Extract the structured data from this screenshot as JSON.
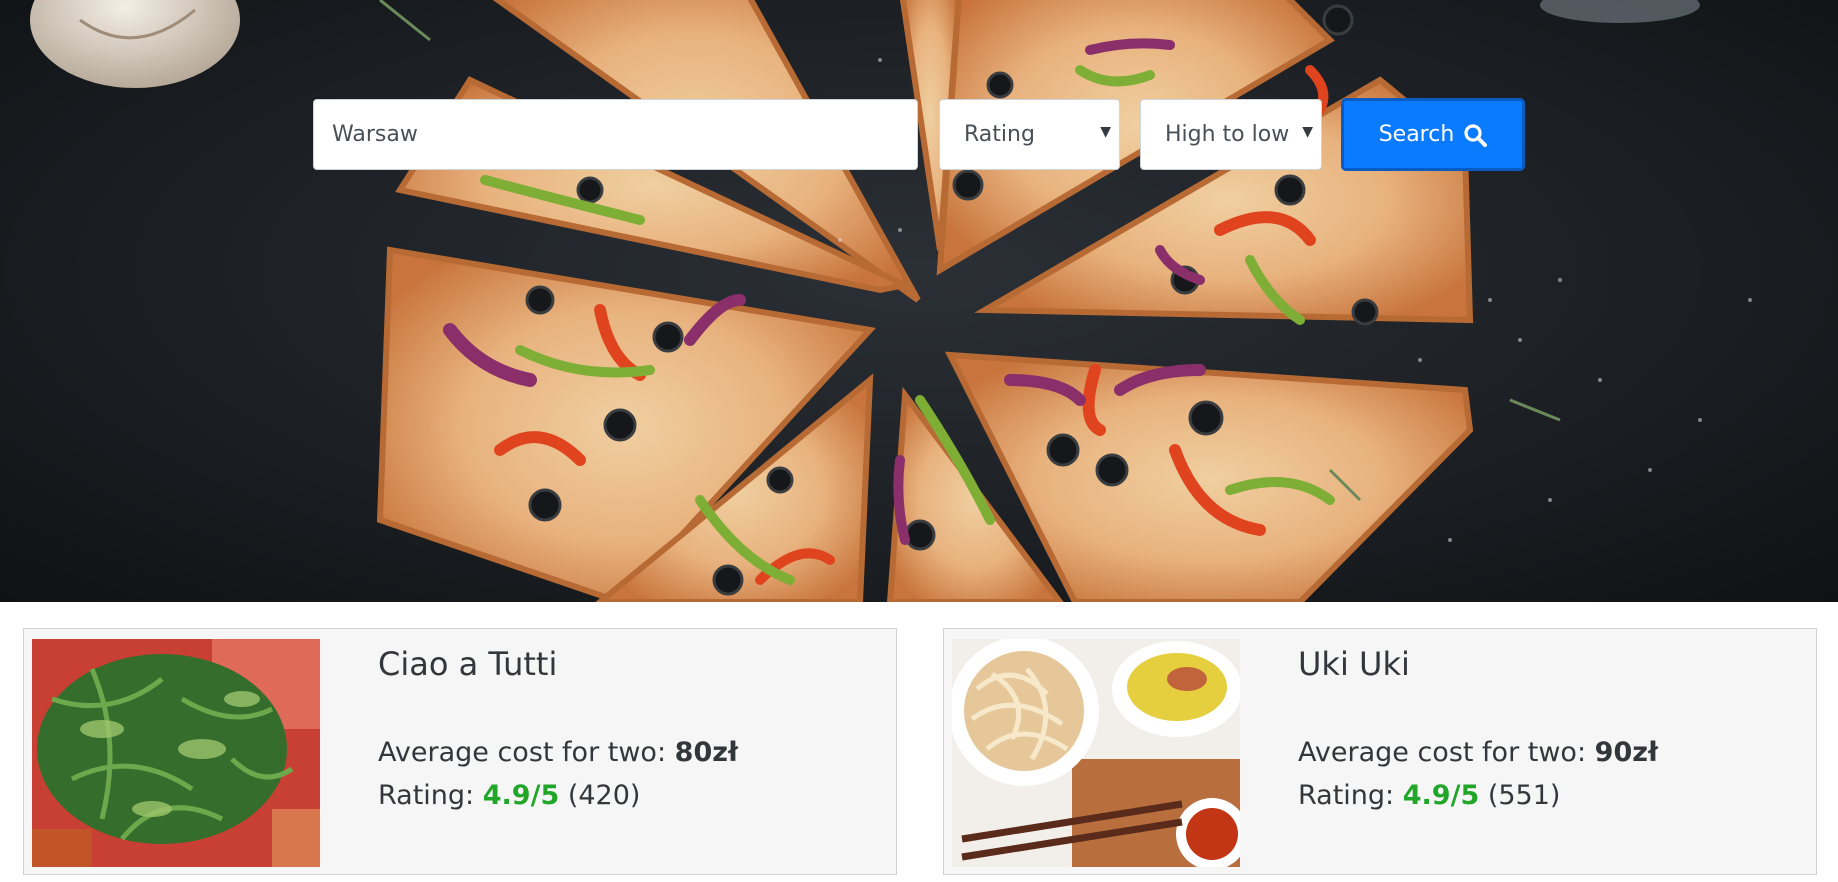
{
  "search": {
    "city_value": "Warsaw",
    "sort_by_value": "Rating",
    "order_value": "High to low",
    "button_label": "Search"
  },
  "results": [
    {
      "name": "Ciao a Tutti",
      "cost_label": "Average cost for two:",
      "cost_value": "80zł",
      "rating_label": "Rating:",
      "rating_value": "4.9/5",
      "rating_count": "(420)",
      "image": "arugula-salad-photo"
    },
    {
      "name": "Uki Uki",
      "cost_label": "Average cost for two:",
      "cost_value": "90zł",
      "rating_label": "Rating:",
      "rating_value": "4.9/5",
      "rating_count": "(551)",
      "image": "udon-noodles-photo"
    }
  ],
  "colors": {
    "button": "#0a7bff",
    "rating": "#22a629",
    "card_bg": "#f6f6f6"
  },
  "icons": {
    "search": "search-icon",
    "dropdown": "caret-down-icon"
  }
}
